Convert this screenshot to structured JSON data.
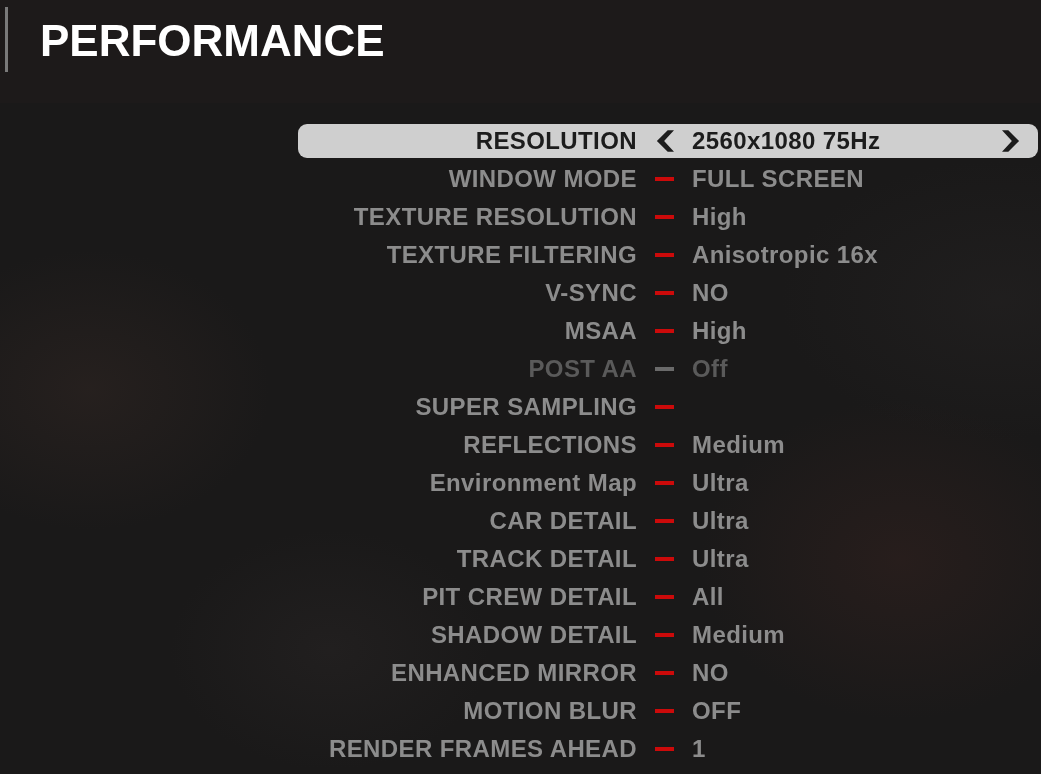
{
  "header": {
    "title": "PERFORMANCE"
  },
  "settings": [
    {
      "label": "RESOLUTION",
      "value": "2560x1080 75Hz",
      "selected": true,
      "disabled": false
    },
    {
      "label": "WINDOW MODE",
      "value": "FULL SCREEN",
      "selected": false,
      "disabled": false
    },
    {
      "label": "TEXTURE RESOLUTION",
      "value": "High",
      "selected": false,
      "disabled": false
    },
    {
      "label": "TEXTURE FILTERING",
      "value": "Anisotropic 16x",
      "selected": false,
      "disabled": false
    },
    {
      "label": "V-SYNC",
      "value": "NO",
      "selected": false,
      "disabled": false
    },
    {
      "label": "MSAA",
      "value": "High",
      "selected": false,
      "disabled": false
    },
    {
      "label": "POST AA",
      "value": "Off",
      "selected": false,
      "disabled": true
    },
    {
      "label": "SUPER SAMPLING",
      "selected": false,
      "disabled": false
    },
    {
      "label": "REFLECTIONS",
      "value": "Medium",
      "selected": false,
      "disabled": false
    },
    {
      "label": "Environment Map",
      "value": "Ultra",
      "selected": false,
      "disabled": false
    },
    {
      "label": "CAR DETAIL",
      "value": "Ultra",
      "selected": false,
      "disabled": false
    },
    {
      "label": "TRACK DETAIL",
      "value": "Ultra",
      "selected": false,
      "disabled": false
    },
    {
      "label": "PIT CREW DETAIL",
      "value": "All",
      "selected": false,
      "disabled": false
    },
    {
      "label": "SHADOW DETAIL",
      "value": "Medium",
      "selected": false,
      "disabled": false
    },
    {
      "label": "ENHANCED MIRROR",
      "value": "NO",
      "selected": false,
      "disabled": false
    },
    {
      "label": "MOTION BLUR",
      "value": "OFF",
      "selected": false,
      "disabled": false
    },
    {
      "label": "RENDER FRAMES AHEAD",
      "value": "1",
      "selected": false,
      "disabled": false
    }
  ]
}
